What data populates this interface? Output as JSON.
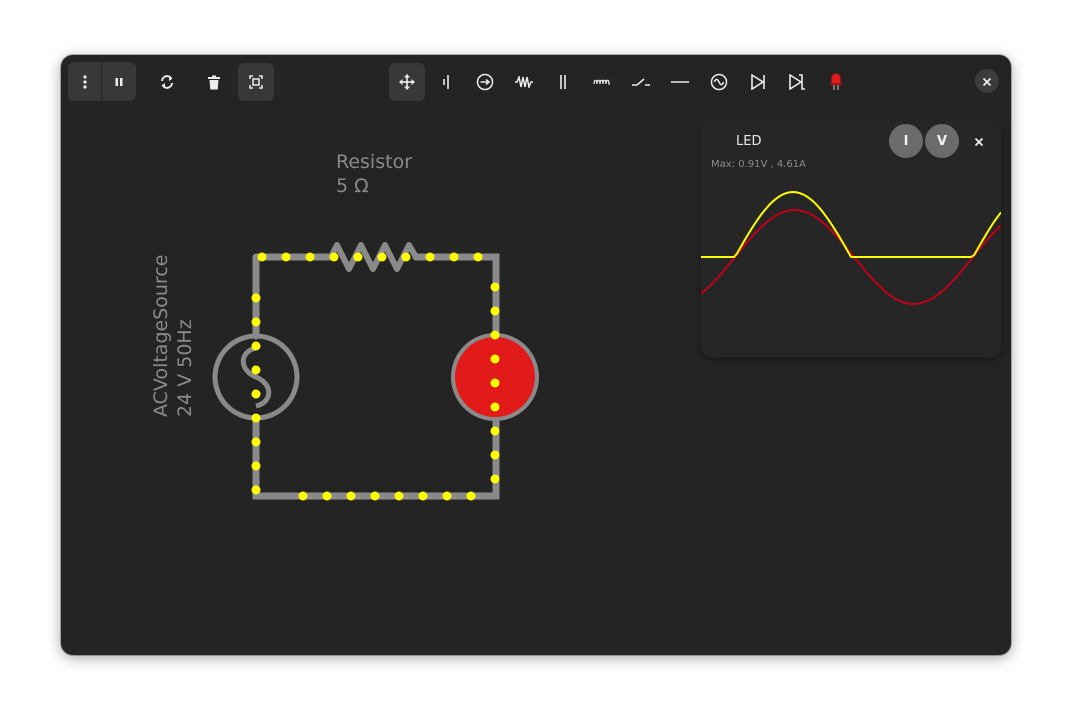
{
  "toolbar": {
    "left": [
      {
        "name": "menu-icon"
      },
      {
        "name": "pause-icon"
      },
      {
        "name": "reset-icon"
      },
      {
        "name": "delete-icon"
      },
      {
        "name": "fit-view-icon"
      }
    ],
    "components": [
      {
        "name": "move-tool-icon",
        "active": true
      },
      {
        "name": "dc-voltage-source-icon"
      },
      {
        "name": "current-source-icon"
      },
      {
        "name": "resistor-icon"
      },
      {
        "name": "capacitor-icon"
      },
      {
        "name": "inductor-icon"
      },
      {
        "name": "switch-icon"
      },
      {
        "name": "wire-icon"
      },
      {
        "name": "ac-voltage-source-icon"
      },
      {
        "name": "diode-icon"
      },
      {
        "name": "zener-diode-icon"
      },
      {
        "name": "led-icon"
      }
    ],
    "close": "close-icon"
  },
  "circuit": {
    "resistor": {
      "name": "Resistor",
      "value": "5 Ω"
    },
    "source": {
      "name": "ACVoltageSource",
      "value": "24 V 50Hz"
    },
    "led_color": "#e31a1a",
    "wire_color": "#8a8a8a",
    "current_dot_color": "#ffff00"
  },
  "scope": {
    "title": "LED",
    "max_readout": "Max: 0.91V , 4.61A",
    "current_button": "I",
    "voltage_button": "V",
    "voltage_color": "#ffff00",
    "current_color": "#c0001a"
  }
}
